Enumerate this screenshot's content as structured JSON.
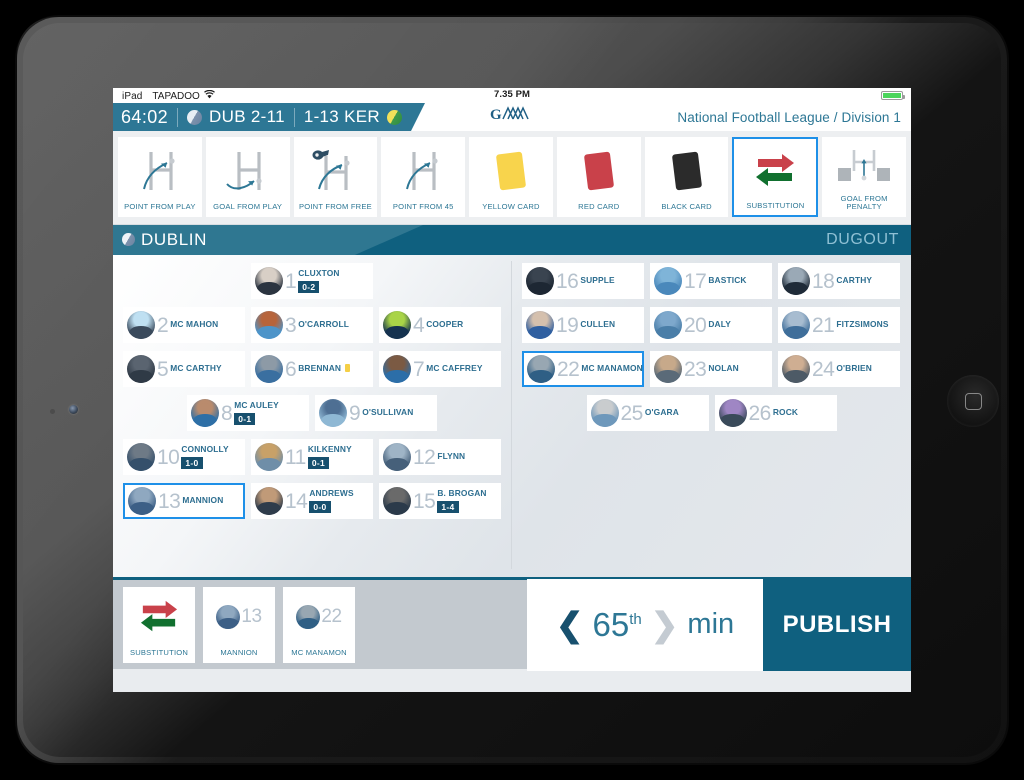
{
  "device": {
    "name": "iPad"
  },
  "status_bar": {
    "device_label": "iPad",
    "carrier": "TAPADOO",
    "wifi_icon": "wifi-icon",
    "time": "7.35 PM",
    "battery_icon": "battery-icon"
  },
  "scoreboard": {
    "clock": "64:02",
    "home_ball_icon": "dublin-ball-icon",
    "home_score": "DUB 2-11",
    "away_score": "1-13 KER",
    "away_ball_icon": "kerry-ball-icon",
    "league_logo": "gaa-logo",
    "league_logo_text": "G≈",
    "competition": "National Football League / Division 1"
  },
  "toolbar": {
    "actions": [
      {
        "label": "POINT FROM PLAY",
        "icon": "posts-point-icon",
        "selected": false
      },
      {
        "label": "GOAL FROM PLAY",
        "icon": "posts-goal-icon",
        "selected": false
      },
      {
        "label": "POINT FROM FREE",
        "icon": "posts-free-whistle-icon",
        "selected": false
      },
      {
        "label": "POINT FROM 45",
        "icon": "posts-45-icon",
        "selected": false
      },
      {
        "label": "YELLOW CARD",
        "icon": "yellow-card-icon",
        "selected": false
      },
      {
        "label": "RED CARD",
        "icon": "red-card-icon",
        "selected": false
      },
      {
        "label": "BLACK CARD",
        "icon": "black-card-icon",
        "selected": false
      },
      {
        "label": "SUBSTITUTION",
        "icon": "substitution-icon",
        "selected": true
      },
      {
        "label": "GOAL FROM PENALTY",
        "icon": "penalty-goal-icon",
        "selected": false
      }
    ]
  },
  "team_bar": {
    "ball_icon": "dublin-ball-icon",
    "team_name": "DUBLIN",
    "dugout_label": "DUGOUT"
  },
  "roster": {
    "starters_rows": [
      [
        {
          "num": "1",
          "name": "CLUXTON",
          "score": "0-2",
          "selected": false,
          "card": null
        }
      ],
      [
        {
          "num": "2",
          "name": "MC MAHON",
          "score": null,
          "selected": false,
          "card": null
        },
        {
          "num": "3",
          "name": "O'CARROLL",
          "score": null,
          "selected": false,
          "card": null
        },
        {
          "num": "4",
          "name": "COOPER",
          "score": null,
          "selected": false,
          "card": null
        }
      ],
      [
        {
          "num": "5",
          "name": "MC CARTHY",
          "score": null,
          "selected": false,
          "card": null
        },
        {
          "num": "6",
          "name": "BRENNAN",
          "score": null,
          "selected": false,
          "card": "yellow"
        },
        {
          "num": "7",
          "name": "MC CAFFREY",
          "score": null,
          "selected": false,
          "card": null
        }
      ],
      [
        {
          "num": "8",
          "name": "MC AULEY",
          "score": "0-1",
          "selected": false,
          "card": null
        },
        {
          "num": "9",
          "name": "O'SULLIVAN",
          "score": null,
          "selected": false,
          "card": null
        }
      ],
      [
        {
          "num": "10",
          "name": "CONNOLLY",
          "score": "1-0",
          "selected": false,
          "card": null
        },
        {
          "num": "11",
          "name": "KILKENNY",
          "score": "0-1",
          "selected": false,
          "card": null
        },
        {
          "num": "12",
          "name": "FLYNN",
          "score": null,
          "selected": false,
          "card": null
        }
      ],
      [
        {
          "num": "13",
          "name": "MANNION",
          "score": null,
          "selected": true,
          "card": null
        },
        {
          "num": "14",
          "name": "ANDREWS",
          "score": "0-0",
          "selected": false,
          "card": null
        },
        {
          "num": "15",
          "name": "B. BROGAN",
          "score": "1-4",
          "selected": false,
          "card": null
        }
      ]
    ],
    "subs_rows": [
      [
        {
          "num": "16",
          "name": "SUPPLE",
          "score": null,
          "selected": false,
          "card": null
        },
        {
          "num": "17",
          "name": "BASTICK",
          "score": null,
          "selected": false,
          "card": null
        },
        {
          "num": "18",
          "name": "CARTHY",
          "score": null,
          "selected": false,
          "card": null
        }
      ],
      [
        {
          "num": "19",
          "name": "CULLEN",
          "score": null,
          "selected": false,
          "card": null
        },
        {
          "num": "20",
          "name": "DALY",
          "score": null,
          "selected": false,
          "card": null
        },
        {
          "num": "21",
          "name": "FITZSIMONS",
          "score": null,
          "selected": false,
          "card": null
        }
      ],
      [
        {
          "num": "22",
          "name": "MC MANAMON",
          "score": null,
          "selected": true,
          "card": null
        },
        {
          "num": "23",
          "name": "NOLAN",
          "score": null,
          "selected": false,
          "card": null
        },
        {
          "num": "24",
          "name": "O'BRIEN",
          "score": null,
          "selected": false,
          "card": null
        }
      ],
      [
        {
          "num": "25",
          "name": "O'GARA",
          "score": null,
          "selected": false,
          "card": null
        },
        {
          "num": "26",
          "name": "ROCK",
          "score": null,
          "selected": false,
          "card": null
        }
      ]
    ]
  },
  "bottom_bar": {
    "tiles": [
      {
        "type": "action",
        "label": "SUBSTITUTION",
        "icon": "substitution-icon",
        "num": null
      },
      {
        "type": "player",
        "label": "MANNION",
        "icon": "player-avatar",
        "num": "13"
      },
      {
        "type": "player",
        "label": "MC MANAMON",
        "icon": "player-avatar",
        "num": "22"
      }
    ],
    "minute": {
      "prev_icon": "chevron-left-icon",
      "value": "65",
      "ordinal": "th",
      "next_icon": "chevron-right-icon",
      "unit": "min"
    },
    "publish_label": "PUBLISH"
  },
  "colors": {
    "brand_dark": "#0f607f",
    "brand_mid": "#2d7795",
    "selection_blue": "#1e90e8",
    "score_badge": "#17506e",
    "yellow_card": "#f8d44c",
    "red_card": "#c9414a",
    "black_card": "#2b2b2b",
    "sub_red_arrow": "#c9414a",
    "sub_green_arrow": "#11702f"
  }
}
